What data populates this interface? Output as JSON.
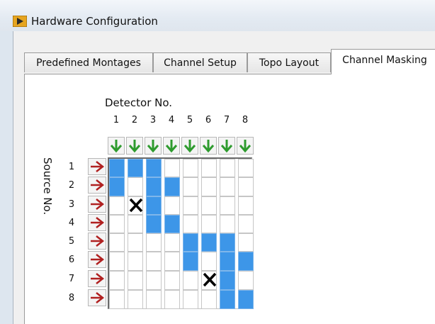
{
  "window": {
    "title": "Hardware Configuration",
    "icon": "labview-app-icon"
  },
  "tabs": [
    {
      "label": "Predefined Montages",
      "active": false
    },
    {
      "label": "Channel Setup",
      "active": false
    },
    {
      "label": "Topo Layout",
      "active": false
    },
    {
      "label": "Channel Masking",
      "active": true
    }
  ],
  "masking": {
    "detector_title": "Detector No.",
    "source_title": "Source No.",
    "detectors": [
      "1",
      "2",
      "3",
      "4",
      "5",
      "6",
      "7",
      "8"
    ],
    "sources": [
      "1",
      "2",
      "3",
      "4",
      "5",
      "6",
      "7",
      "8"
    ],
    "detector_button_icon": "down-arrow-icon",
    "source_button_icon": "right-arrow-icon",
    "matrix": [
      [
        1,
        1,
        1,
        0,
        0,
        0,
        0,
        0
      ],
      [
        1,
        0,
        1,
        1,
        0,
        0,
        0,
        0
      ],
      [
        0,
        2,
        1,
        0,
        0,
        0,
        0,
        0
      ],
      [
        0,
        0,
        1,
        1,
        0,
        0,
        0,
        0
      ],
      [
        0,
        0,
        0,
        0,
        1,
        1,
        1,
        0
      ],
      [
        0,
        0,
        0,
        0,
        1,
        0,
        1,
        1
      ],
      [
        0,
        0,
        0,
        0,
        0,
        2,
        1,
        0
      ],
      [
        0,
        0,
        0,
        0,
        0,
        0,
        1,
        1
      ]
    ],
    "matrix_legend": {
      "0": "off",
      "1": "active-channel",
      "2": "masked-channel"
    },
    "colors": {
      "active": "#3d96e8",
      "down_arrow": "#2e9b2e",
      "right_arrow": "#b02020",
      "mask_x": "#000000"
    }
  }
}
